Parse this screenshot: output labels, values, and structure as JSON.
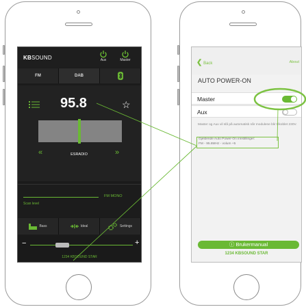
{
  "left_app": {
    "brand_bold": "KB",
    "brand_rest": "SOUND",
    "power_aux_label": "Aux",
    "power_master_label": "Master",
    "tabs": [
      {
        "label": "FM"
      },
      {
        "label": "DAB"
      },
      {
        "label": "",
        "icon": "bluetooth-icon"
      }
    ],
    "frequency": "95.8",
    "station": "ESRADIO",
    "scan_label": "Scan level",
    "mono_label": "FM MONO",
    "bottom_tabs": [
      {
        "label": "Bass",
        "icon": "bass-icon"
      },
      {
        "label": "Ideal",
        "icon": "ideal-icon"
      },
      {
        "label": "Settings",
        "icon": "settings-icon"
      }
    ],
    "volume_minus": "−",
    "volume_plus": "+",
    "volume_level_fraction": 0.3,
    "device_name": "1234 KBSOUND STAR",
    "nav_prev": "«",
    "nav_next": "»",
    "accent_color": "#6ab934"
  },
  "right_app": {
    "back_label": "Back",
    "about_label": "About",
    "title": "AUTO POWER-ON",
    "rows": [
      {
        "label": "Master",
        "state": "on"
      },
      {
        "label": "Aux",
        "state": "off"
      }
    ],
    "description": "Master og Aux vil slå på automatisk når modulene blir tilkoblet 230V.",
    "info_line1": "Gjeldende Auto Power-On innstillinger:",
    "info_line2": "FM - 95.8MHz - volum +5",
    "manual_button": "ⓘ Brukermanual",
    "device_name": "1234 KBSOUND STAR",
    "accent_color": "#7cc242"
  }
}
